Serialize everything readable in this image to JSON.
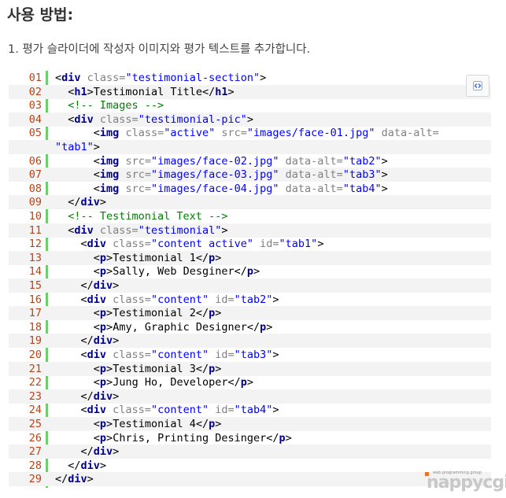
{
  "heading": "사용 방법:",
  "step_text": "1. 평가 슬라이더에 작성자 이미지와 평가 텍스트를 추가합니다.",
  "copy_icon": "view-source-icon",
  "watermark": {
    "small": "web programming group",
    "main": "nappycgi"
  },
  "lines": [
    [
      [
        "p",
        "<"
      ],
      [
        "tag",
        "div"
      ],
      [
        "p",
        " "
      ],
      [
        "attr",
        "class="
      ],
      [
        "str",
        "\"testimonial-section\""
      ],
      [
        "p",
        ">"
      ]
    ],
    [
      [
        "p",
        "  <"
      ],
      [
        "tag",
        "h1"
      ],
      [
        "p",
        ">"
      ],
      [
        "text",
        "Testimonial Title"
      ],
      [
        "p",
        "</"
      ],
      [
        "tag",
        "h1"
      ],
      [
        "p",
        ">"
      ]
    ],
    [
      [
        "cmt",
        "  <!-- Images -->"
      ]
    ],
    [
      [
        "p",
        "  <"
      ],
      [
        "tag",
        "div"
      ],
      [
        "p",
        " "
      ],
      [
        "attr",
        "class="
      ],
      [
        "str",
        "\"testimonial-pic\""
      ],
      [
        "p",
        ">"
      ]
    ],
    [
      [
        "p",
        "      <"
      ],
      [
        "tag",
        "img"
      ],
      [
        "p",
        " "
      ],
      [
        "attr",
        "class="
      ],
      [
        "str",
        "\"active\""
      ],
      [
        "p",
        " "
      ],
      [
        "attr",
        "src="
      ],
      [
        "str",
        "\"images/face-01.jpg\""
      ],
      [
        "p",
        " "
      ],
      [
        "attr",
        "data-alt="
      ]
    ],
    [
      [
        "str",
        "\"tab1\""
      ],
      [
        "p",
        ">"
      ]
    ],
    [
      [
        "p",
        "      <"
      ],
      [
        "tag",
        "img"
      ],
      [
        "p",
        " "
      ],
      [
        "attr",
        "src="
      ],
      [
        "str",
        "\"images/face-02.jpg\""
      ],
      [
        "p",
        " "
      ],
      [
        "attr",
        "data-alt="
      ],
      [
        "str",
        "\"tab2\""
      ],
      [
        "p",
        ">"
      ]
    ],
    [
      [
        "p",
        "      <"
      ],
      [
        "tag",
        "img"
      ],
      [
        "p",
        " "
      ],
      [
        "attr",
        "src="
      ],
      [
        "str",
        "\"images/face-03.jpg\""
      ],
      [
        "p",
        " "
      ],
      [
        "attr",
        "data-alt="
      ],
      [
        "str",
        "\"tab3\""
      ],
      [
        "p",
        ">"
      ]
    ],
    [
      [
        "p",
        "      <"
      ],
      [
        "tag",
        "img"
      ],
      [
        "p",
        " "
      ],
      [
        "attr",
        "src="
      ],
      [
        "str",
        "\"images/face-04.jpg\""
      ],
      [
        "p",
        " "
      ],
      [
        "attr",
        "data-alt="
      ],
      [
        "str",
        "\"tab4\""
      ],
      [
        "p",
        ">"
      ]
    ],
    [
      [
        "p",
        "  </"
      ],
      [
        "tag",
        "div"
      ],
      [
        "p",
        ">"
      ]
    ],
    [
      [
        "cmt",
        "  <!-- Testimonial Text -->"
      ]
    ],
    [
      [
        "p",
        "  <"
      ],
      [
        "tag",
        "div"
      ],
      [
        "p",
        " "
      ],
      [
        "attr",
        "class="
      ],
      [
        "str",
        "\"testimonial\""
      ],
      [
        "p",
        ">"
      ]
    ],
    [
      [
        "p",
        "    <"
      ],
      [
        "tag",
        "div"
      ],
      [
        "p",
        " "
      ],
      [
        "attr",
        "class="
      ],
      [
        "str",
        "\"content active\""
      ],
      [
        "p",
        " "
      ],
      [
        "attr",
        "id="
      ],
      [
        "str",
        "\"tab1\""
      ],
      [
        "p",
        ">"
      ]
    ],
    [
      [
        "p",
        "      <"
      ],
      [
        "tag",
        "p"
      ],
      [
        "p",
        ">"
      ],
      [
        "text",
        "Testimonial 1"
      ],
      [
        "p",
        "</"
      ],
      [
        "tag",
        "p"
      ],
      [
        "p",
        ">"
      ]
    ],
    [
      [
        "p",
        "      <"
      ],
      [
        "tag",
        "p"
      ],
      [
        "p",
        ">"
      ],
      [
        "text",
        "Sally, Web Desginer"
      ],
      [
        "p",
        "</"
      ],
      [
        "tag",
        "p"
      ],
      [
        "p",
        ">"
      ]
    ],
    [
      [
        "p",
        "    </"
      ],
      [
        "tag",
        "div"
      ],
      [
        "p",
        ">"
      ]
    ],
    [
      [
        "p",
        "    <"
      ],
      [
        "tag",
        "div"
      ],
      [
        "p",
        " "
      ],
      [
        "attr",
        "class="
      ],
      [
        "str",
        "\"content\""
      ],
      [
        "p",
        " "
      ],
      [
        "attr",
        "id="
      ],
      [
        "str",
        "\"tab2\""
      ],
      [
        "p",
        ">"
      ]
    ],
    [
      [
        "p",
        "      <"
      ],
      [
        "tag",
        "p"
      ],
      [
        "p",
        ">"
      ],
      [
        "text",
        "Testimonial 2"
      ],
      [
        "p",
        "</"
      ],
      [
        "tag",
        "p"
      ],
      [
        "p",
        ">"
      ]
    ],
    [
      [
        "p",
        "      <"
      ],
      [
        "tag",
        "p"
      ],
      [
        "p",
        ">"
      ],
      [
        "text",
        "Amy, Graphic Designer"
      ],
      [
        "p",
        "</"
      ],
      [
        "tag",
        "p"
      ],
      [
        "p",
        ">"
      ]
    ],
    [
      [
        "p",
        "    </"
      ],
      [
        "tag",
        "div"
      ],
      [
        "p",
        ">"
      ]
    ],
    [
      [
        "p",
        "    <"
      ],
      [
        "tag",
        "div"
      ],
      [
        "p",
        " "
      ],
      [
        "attr",
        "class="
      ],
      [
        "str",
        "\"content\""
      ],
      [
        "p",
        " "
      ],
      [
        "attr",
        "id="
      ],
      [
        "str",
        "\"tab3\""
      ],
      [
        "p",
        ">"
      ]
    ],
    [
      [
        "p",
        "      <"
      ],
      [
        "tag",
        "p"
      ],
      [
        "p",
        ">"
      ],
      [
        "text",
        "Testimonial 3"
      ],
      [
        "p",
        "</"
      ],
      [
        "tag",
        "p"
      ],
      [
        "p",
        ">"
      ]
    ],
    [
      [
        "p",
        "      <"
      ],
      [
        "tag",
        "p"
      ],
      [
        "p",
        ">"
      ],
      [
        "text",
        "Jung Ho, Developer"
      ],
      [
        "p",
        "</"
      ],
      [
        "tag",
        "p"
      ],
      [
        "p",
        ">"
      ]
    ],
    [
      [
        "p",
        "    </"
      ],
      [
        "tag",
        "div"
      ],
      [
        "p",
        ">"
      ]
    ],
    [
      [
        "p",
        "    <"
      ],
      [
        "tag",
        "div"
      ],
      [
        "p",
        " "
      ],
      [
        "attr",
        "class="
      ],
      [
        "str",
        "\"content\""
      ],
      [
        "p",
        " "
      ],
      [
        "attr",
        "id="
      ],
      [
        "str",
        "\"tab4\""
      ],
      [
        "p",
        ">"
      ]
    ],
    [
      [
        "p",
        "      <"
      ],
      [
        "tag",
        "p"
      ],
      [
        "p",
        ">"
      ],
      [
        "text",
        "Testimonial 4"
      ],
      [
        "p",
        "</"
      ],
      [
        "tag",
        "p"
      ],
      [
        "p",
        ">"
      ]
    ],
    [
      [
        "p",
        "      <"
      ],
      [
        "tag",
        "p"
      ],
      [
        "p",
        ">"
      ],
      [
        "text",
        "Chris, Printing Desinger"
      ],
      [
        "p",
        "</"
      ],
      [
        "tag",
        "p"
      ],
      [
        "p",
        ">"
      ]
    ],
    [
      [
        "p",
        "    </"
      ],
      [
        "tag",
        "div"
      ],
      [
        "p",
        ">"
      ]
    ],
    [
      [
        "p",
        "  </"
      ],
      [
        "tag",
        "div"
      ],
      [
        "p",
        ">"
      ]
    ],
    [
      [
        "p",
        "</"
      ],
      [
        "tag",
        "div"
      ],
      [
        "p",
        ">"
      ]
    ]
  ],
  "line_numbers": [
    "01",
    "02",
    "03",
    "04",
    "05",
    "",
    "06",
    "07",
    "08",
    "09",
    "10",
    "11",
    "12",
    "13",
    "14",
    "15",
    "16",
    "17",
    "18",
    "19",
    "20",
    "21",
    "22",
    "23",
    "24",
    "25",
    "26",
    "27",
    "28",
    "29"
  ]
}
